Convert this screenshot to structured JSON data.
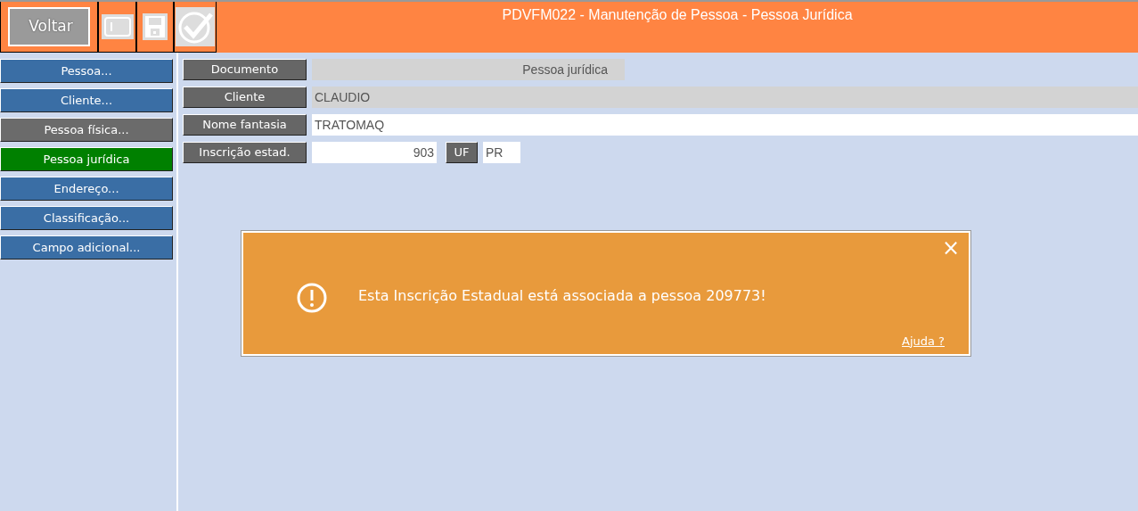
{
  "toolbar": {
    "back_label": "Voltar",
    "title": "PDVFM022 - Manutenção de Pessoa - Pessoa Jurídica"
  },
  "sidebar": {
    "items": [
      {
        "label": "Pessoa...",
        "selected": false,
        "disabled": false
      },
      {
        "label": "Cliente...",
        "selected": false,
        "disabled": false
      },
      {
        "label": "Pessoa física...",
        "selected": false,
        "disabled": true
      },
      {
        "label": "Pessoa jurídica",
        "selected": true,
        "disabled": false
      },
      {
        "label": "Endereço...",
        "selected": false,
        "disabled": false
      },
      {
        "label": "Classificação...",
        "selected": false,
        "disabled": false
      },
      {
        "label": "Campo adicional...",
        "selected": false,
        "disabled": false
      }
    ]
  },
  "form": {
    "documento": {
      "label": "Documento",
      "type": "Pessoa jurídica"
    },
    "cliente": {
      "label": "Cliente",
      "value": "CLAUDIO"
    },
    "nome_fantasia": {
      "label": "Nome fantasia",
      "value": "TRATOMAQ"
    },
    "inscricao": {
      "label": "Inscrição estad.",
      "value": "903",
      "uf_label": "UF",
      "uf_value": "PR"
    }
  },
  "alert": {
    "message": "Esta Inscrição Estadual está associada a pessoa 209773!",
    "close": "×",
    "help_link": "Ajuda ?"
  }
}
